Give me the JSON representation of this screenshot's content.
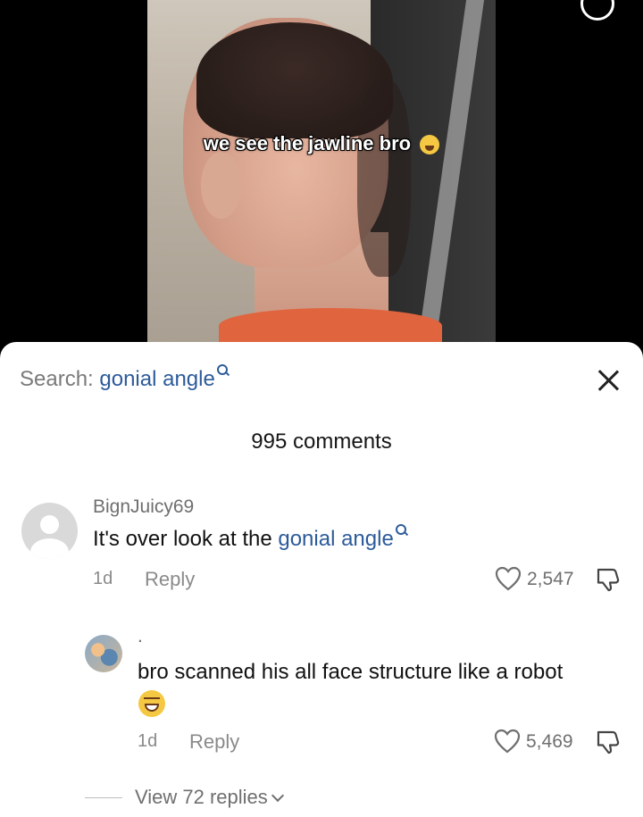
{
  "video": {
    "caption": "we see the jawline bro"
  },
  "sheet": {
    "search_label": "Search:",
    "search_term": "gonial angle",
    "comments_count": "995 comments"
  },
  "comments": [
    {
      "username": "BignJuicy69",
      "text_prefix": "It's over look at the ",
      "text_link": "gonial angle",
      "time": "1d",
      "reply": "Reply",
      "likes": "2,547"
    },
    {
      "username": ".",
      "text": "bro scanned his all face structure like a robot",
      "time": "1d",
      "reply": "Reply",
      "likes": "5,469"
    }
  ],
  "view_replies": "View 72 replies",
  "colors": {
    "link": "#2d5b9a",
    "muted": "#8a8a8a"
  }
}
